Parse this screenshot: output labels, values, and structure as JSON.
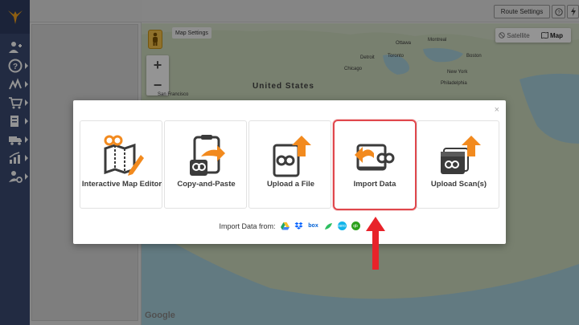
{
  "topbar": {
    "route_settings_label": "Route Settings",
    "help_icon": "question-circle-icon",
    "bolt_icon": "bolt-icon"
  },
  "nav": {
    "items": [
      {
        "icon": "add-user-icon"
      },
      {
        "icon": "help-icon"
      },
      {
        "icon": "route-icon"
      },
      {
        "icon": "cart-icon"
      },
      {
        "icon": "orders-icon"
      },
      {
        "icon": "truck-icon"
      },
      {
        "icon": "analytics-icon"
      },
      {
        "icon": "user-settings-icon"
      }
    ]
  },
  "map": {
    "settings_label": "Map Settings",
    "satellite_label": "Satellite",
    "map_label": "Map",
    "country_label": "United States",
    "cities": [
      "Ottawa",
      "Montreal",
      "Toronto",
      "Boston",
      "New York",
      "Chicago",
      "Philadelphia",
      "San Francisco",
      "Detroit"
    ],
    "attribution": "Google"
  },
  "modal": {
    "close": "×",
    "options": [
      {
        "label": "Interactive Map Editor"
      },
      {
        "label": "Copy-and-Paste"
      },
      {
        "label": "Upload a File"
      },
      {
        "label": "Import Data"
      },
      {
        "label": "Upload Scan(s)"
      }
    ],
    "import_from_label": "Import Data from:",
    "import_sources": [
      "google-drive-icon",
      "dropbox-icon",
      "box-icon",
      "evernote-icon",
      "xero-icon",
      "quickbooks-icon"
    ],
    "box_text": "box",
    "xero_text": "xero",
    "qb_text": "qb"
  },
  "colors": {
    "accent_orange": "#f28a1e",
    "icon_dark": "#3b3b3b",
    "highlight_red": "#e0474c",
    "nav_bg": "#3b4a72"
  }
}
